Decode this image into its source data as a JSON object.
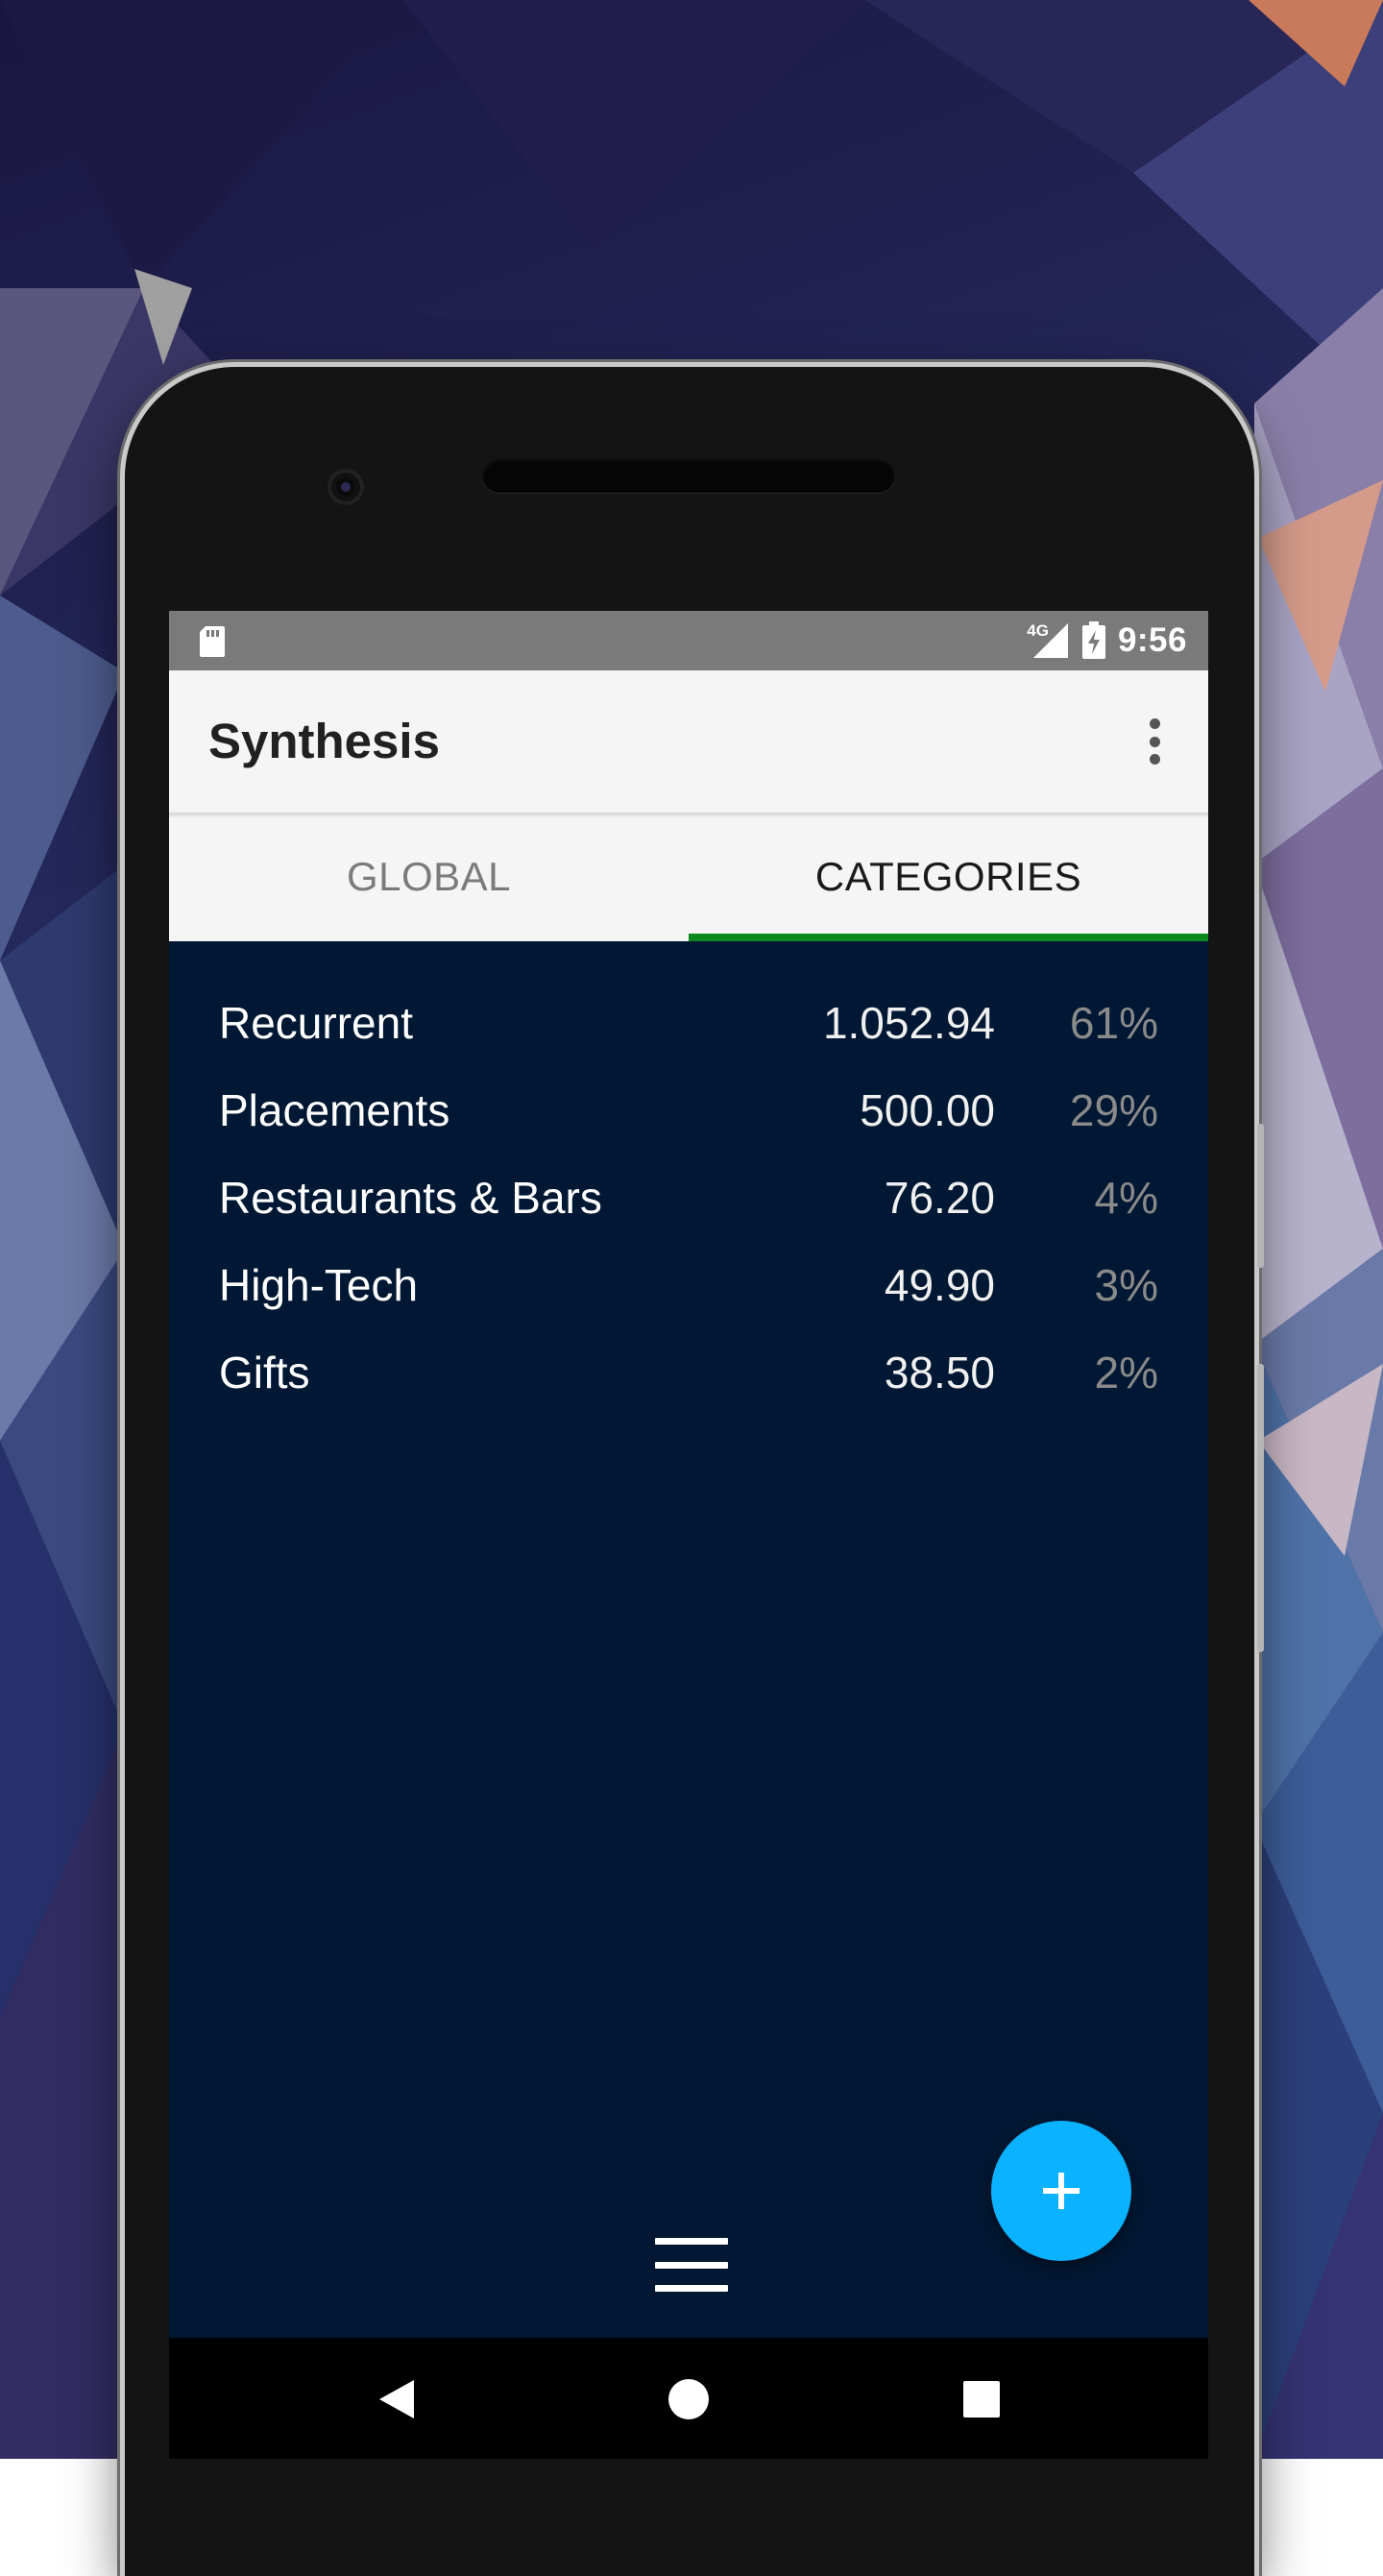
{
  "status_bar": {
    "network": "4G",
    "time": "9:56",
    "icons": [
      "sd-card-icon",
      "signal-icon",
      "battery-charging-icon"
    ]
  },
  "app_bar": {
    "title": "Synthesis",
    "menu_icon": "more-vert-icon"
  },
  "tabs": [
    {
      "label": "GLOBAL",
      "active": false
    },
    {
      "label": "CATEGORIES",
      "active": true
    }
  ],
  "categories": [
    {
      "name": "Recurrent",
      "amount": "1.052.94",
      "percent": "61%"
    },
    {
      "name": "Placements",
      "amount": "500.00",
      "percent": "29%"
    },
    {
      "name": "Restaurants & Bars",
      "amount": "76.20",
      "percent": "4%"
    },
    {
      "name": "High-Tech",
      "amount": "49.90",
      "percent": "3%"
    },
    {
      "name": "Gifts",
      "amount": "38.50",
      "percent": "2%"
    }
  ],
  "fab": {
    "icon": "plus-icon"
  },
  "bottom_menu": {
    "icon": "hamburger-menu-icon"
  },
  "nav_bar": {
    "buttons": [
      "back-icon",
      "home-icon",
      "recents-icon"
    ]
  },
  "colors": {
    "content_bg": "#001833",
    "tab_indicator": "#0d8a1f",
    "fab": "#0ab2ff",
    "status_bar": "#7a7a7a",
    "app_bar": "#f5f5f5"
  }
}
